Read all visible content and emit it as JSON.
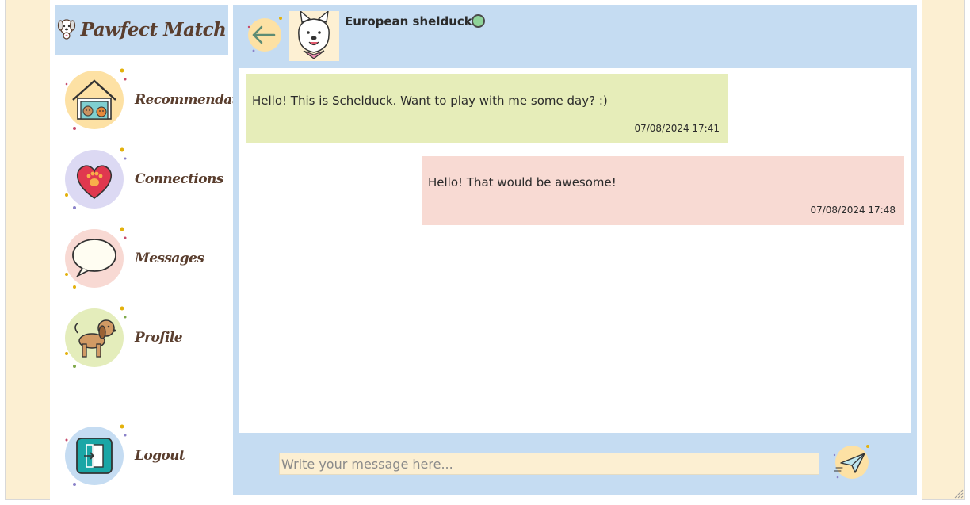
{
  "app": {
    "brand_name": "Pawfect Match"
  },
  "sidebar": {
    "items": [
      {
        "label": "Recommendations",
        "icon": "dog-cat-house-icon"
      },
      {
        "label": "Connections",
        "icon": "heart-paw-icon"
      },
      {
        "label": "Messages",
        "icon": "speech-bubble-icon"
      },
      {
        "label": "Profile",
        "icon": "dog-icon"
      },
      {
        "label": "Logout",
        "icon": "exit-door-icon"
      }
    ]
  },
  "chat": {
    "contact_name": "European shelduck",
    "status": "online",
    "messages": [
      {
        "direction": "incoming",
        "text": "Hello! This is Schelduck. Want to play with me some day? :)",
        "time": "07/08/2024 17:41"
      },
      {
        "direction": "outgoing",
        "text": "Hello! That would be awesome!",
        "time": "07/08/2024 17:48"
      }
    ],
    "composer": {
      "placeholder": "Write your message here...",
      "value": ""
    }
  },
  "colors": {
    "page_background": "#fcefd2",
    "panel_blue": "#c5dcf2",
    "incoming_bubble": "#e6edb9",
    "outgoing_bubble": "#f8dad3",
    "online": "#8fd49a",
    "brand_text": "#5a3e2e"
  }
}
